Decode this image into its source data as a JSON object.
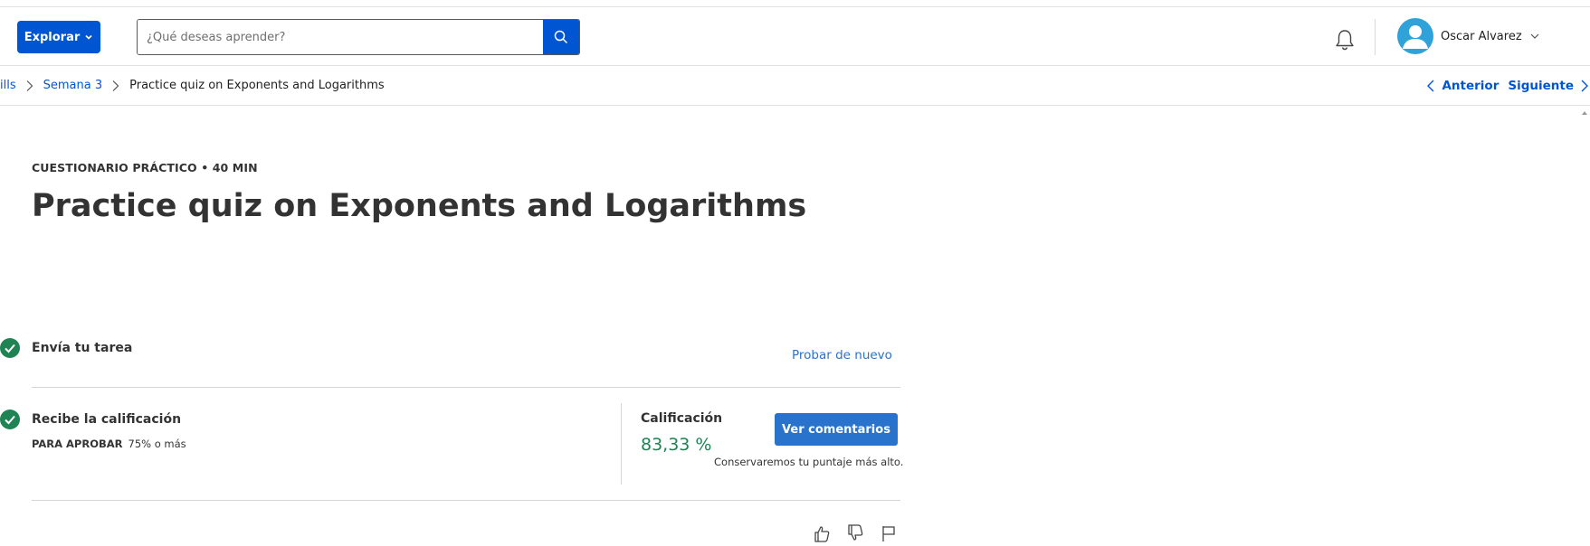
{
  "header": {
    "explore_label": "Explorar",
    "search_placeholder": "¿Qué deseas aprender?",
    "user_name": "Oscar Alvarez"
  },
  "breadcrumb": {
    "items": [
      "ills",
      "Semana 3"
    ],
    "current": "Practice quiz on Exponents and Logarithms",
    "prev_label": "Anterior",
    "next_label": "Siguiente"
  },
  "quiz": {
    "eyebrow": "CUESTIONARIO PRÁCTICO • 40 MIN",
    "title": "Practice quiz on Exponents and Logarithms"
  },
  "steps": {
    "submit": {
      "title": "Envía tu tarea",
      "retry_label": "Probar de nuevo"
    },
    "grade": {
      "title": "Recibe la calificación",
      "pass_label": "PARA APROBAR",
      "pass_value": "75% o más",
      "grade_label": "Calificación",
      "grade_value": "83,33 %",
      "feedback_label": "Ver comentarios",
      "keep_note": "Conservaremos tu puntaje más alto."
    }
  },
  "colors": {
    "brand": "#0056d2",
    "button": "#2a73cc",
    "success": "#1f8354"
  },
  "icons": {
    "bell": "bell-icon",
    "search": "search-icon",
    "check": "check-circle-icon",
    "thumbs_up": "thumbs-up-icon",
    "thumbs_down": "thumbs-down-icon",
    "flag": "flag-icon"
  }
}
